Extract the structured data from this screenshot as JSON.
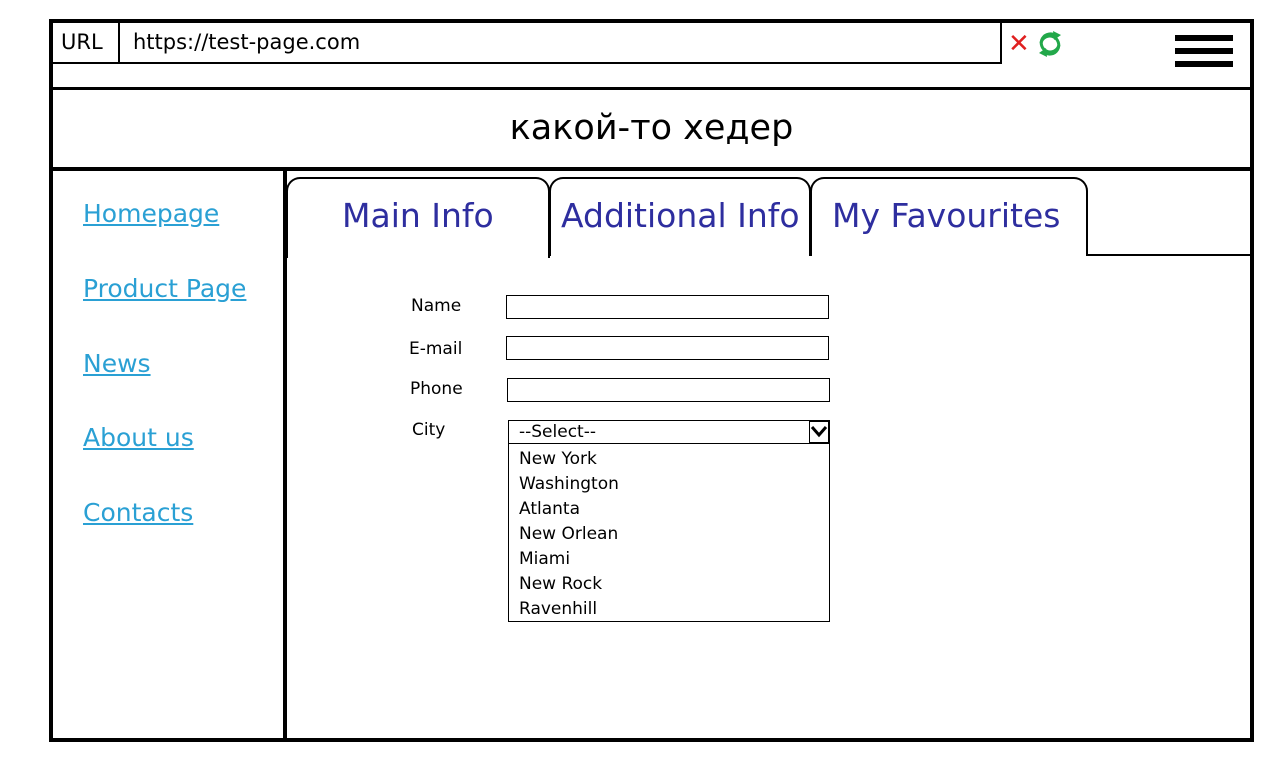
{
  "browser": {
    "url_label": "URL",
    "url_value": "https://test-page.com",
    "stop_icon": "close-icon",
    "reload_icon": "refresh-icon",
    "menu_icon": "hamburger-icon",
    "colors": {
      "stop": "#e02020",
      "reload": "#22a84a"
    }
  },
  "header": {
    "title": "какой-то хедер"
  },
  "sidebar": {
    "link_color": "#2aa0d4",
    "items": [
      {
        "label": "Homepage"
      },
      {
        "label": "Product Page"
      },
      {
        "label": "News"
      },
      {
        "label": "About us"
      },
      {
        "label": "Contacts"
      }
    ]
  },
  "tabs": {
    "color": "#2e2e9f",
    "items": [
      {
        "label": "Main Info",
        "active": true
      },
      {
        "label": "Additional Info",
        "active": false
      },
      {
        "label": "My Favourites",
        "active": false
      }
    ]
  },
  "form": {
    "name_label": "Name",
    "email_label": "E-mail",
    "phone_label": "Phone",
    "city_label": "City",
    "name_value": "",
    "email_value": "",
    "phone_value": "",
    "city_selected": "--Select--",
    "city_options": [
      "New York",
      "Washington",
      "Atlanta",
      "New Orlean",
      "Miami",
      "New Rock",
      "Ravenhill"
    ]
  }
}
